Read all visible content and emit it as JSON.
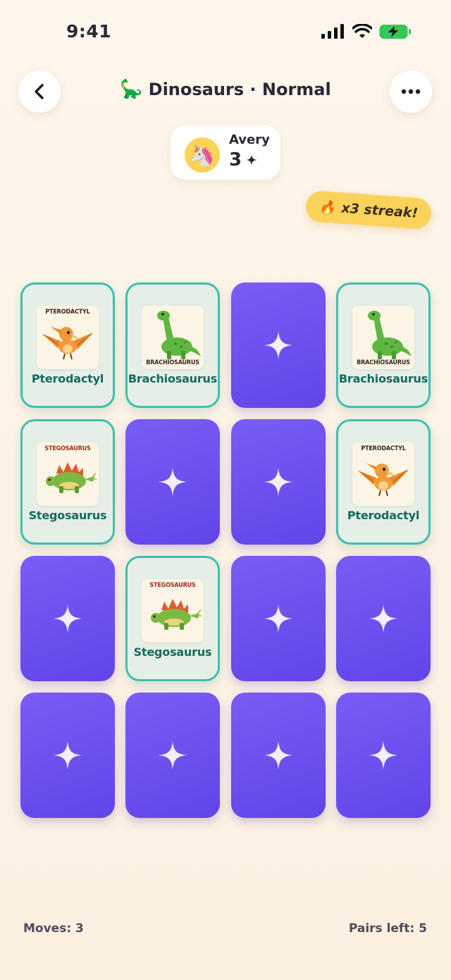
{
  "status_bar": {
    "time": "9:41"
  },
  "header": {
    "title_icon": "🦕",
    "title": "Dinosaurs · Normal",
    "back_icon": "chevron-left-icon",
    "more_icon": "ellipsis-icon"
  },
  "player": {
    "avatar": "🦄",
    "name": "Avery",
    "score": "3",
    "score_icon": "sparkle-icon"
  },
  "streak": {
    "icon": "🔥",
    "label": "x3 streak!"
  },
  "board": {
    "cards": [
      {
        "state": "face",
        "kind": "pterodactyl",
        "image_text": "PTERODACTYL",
        "label": "Pterodactyl"
      },
      {
        "state": "face",
        "kind": "brachiosaurus",
        "image_text": "BRACHIOSAURUS",
        "label": "Brachiosaurus"
      },
      {
        "state": "back"
      },
      {
        "state": "face",
        "kind": "brachiosaurus",
        "image_text": "BRACHIOSAURUS",
        "label": "Brachiosaurus"
      },
      {
        "state": "face",
        "kind": "stegosaurus",
        "image_text": "STEGOSAURUS",
        "label": "Stegosaurus"
      },
      {
        "state": "back"
      },
      {
        "state": "back"
      },
      {
        "state": "face",
        "kind": "pterodactyl",
        "image_text": "PTERODACTYL",
        "label": "Pterodactyl"
      },
      {
        "state": "back"
      },
      {
        "state": "face",
        "kind": "stegosaurus",
        "image_text": "STEGOSAURUS",
        "label": "Stegosaurus"
      },
      {
        "state": "back"
      },
      {
        "state": "back"
      },
      {
        "state": "back"
      },
      {
        "state": "back"
      },
      {
        "state": "back"
      },
      {
        "state": "back"
      }
    ]
  },
  "footer": {
    "moves": "Moves: 3",
    "pairs_left": "Pairs left: 5"
  },
  "colors": {
    "card_back": "#6b4ff0",
    "card_face_border": "#3fbfae",
    "card_face_label": "#136a5d",
    "streak_bg": "#fcd35a"
  }
}
